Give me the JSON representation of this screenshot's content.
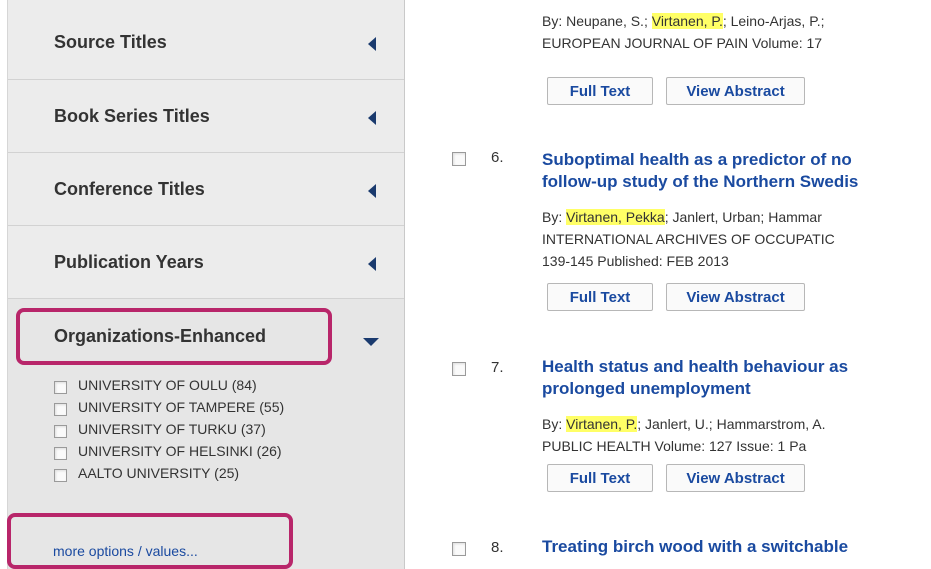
{
  "sidebar": {
    "facets": [
      {
        "label": "Source Titles"
      },
      {
        "label": "Book Series Titles"
      },
      {
        "label": "Conference Titles"
      },
      {
        "label": "Publication Years"
      }
    ],
    "open_facet": {
      "label": "Organizations-Enhanced",
      "items": [
        {
          "label": "UNIVERSITY OF OULU (84)"
        },
        {
          "label": "UNIVERSITY OF TAMPERE (55)"
        },
        {
          "label": "UNIVERSITY OF TURKU (37)"
        },
        {
          "label": "UNIVERSITY OF HELSINKI (26)"
        },
        {
          "label": "AALTO UNIVERSITY (25)"
        }
      ],
      "more_link": "more options / values..."
    }
  },
  "results": {
    "partial_record": {
      "authors_prefix": "By: Neupane, S.; ",
      "authors_highlight": "Virtanen, P.",
      "authors_suffix": "; Leino-Arjas, P.;",
      "source": "EUROPEAN JOURNAL OF PAIN  Volume: 17"
    },
    "records": [
      {
        "number": "6.",
        "title_line1": "Suboptimal health as a predictor of no",
        "title_line2": "follow-up study of the Northern Swedis",
        "authors_prefix": "By: ",
        "authors_highlight": "Virtanen, Pekka",
        "authors_suffix": "; Janlert, Urban; Hammar",
        "source_line1": "INTERNATIONAL ARCHIVES OF OCCUPATIC",
        "source_line2": "139-145   Published: FEB 2013"
      },
      {
        "number": "7.",
        "title_line1": "Health status and health behaviour as",
        "title_line2": "prolonged unemployment",
        "authors_prefix": "By: ",
        "authors_highlight": "Virtanen, P.",
        "authors_suffix": "; Janlert, U.; Hammarstrom, A.",
        "source_line1": "PUBLIC HEALTH  Volume: 127   Issue: 1   Pa"
      },
      {
        "number": "8.",
        "title_line1": "Treating birch wood with a switchable"
      }
    ],
    "buttons": {
      "full_text": "Full Text",
      "view_abstract": "View Abstract"
    }
  },
  "colors": {
    "link": "#1a4aa0",
    "highlight": "#ffff66",
    "annotation_box": "#b8266a",
    "sidebar_bg": "#ececec"
  }
}
